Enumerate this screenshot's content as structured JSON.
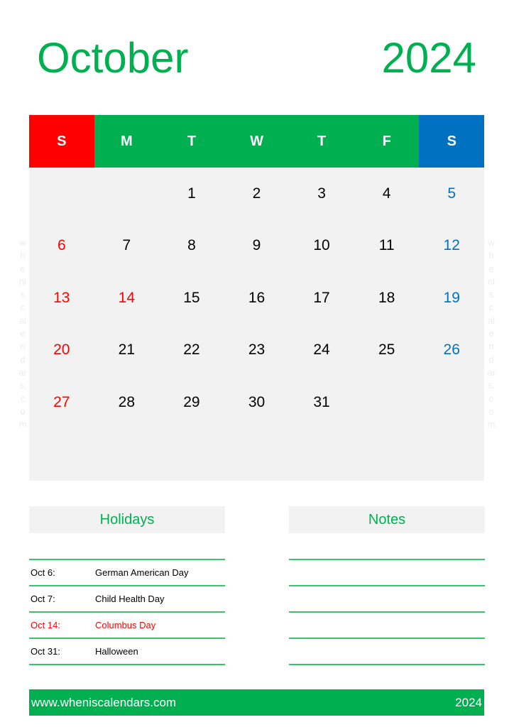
{
  "header": {
    "month": "October",
    "year": "2024"
  },
  "weekdays": [
    "S",
    "M",
    "T",
    "W",
    "T",
    "F",
    "S"
  ],
  "colors": {
    "accent": "#00b050",
    "sunday": "#ff0000",
    "saturday": "#0070c0",
    "grid_bg": "#f2f2f2"
  },
  "weeks": [
    [
      "",
      "",
      "1",
      "2",
      "3",
      "4",
      "5"
    ],
    [
      "6",
      "7",
      "8",
      "9",
      "10",
      "11",
      "12"
    ],
    [
      "13",
      "14",
      "15",
      "16",
      "17",
      "18",
      "19"
    ],
    [
      "20",
      "21",
      "22",
      "23",
      "24",
      "25",
      "26"
    ],
    [
      "27",
      "28",
      "29",
      "30",
      "31",
      "",
      ""
    ],
    [
      "",
      "",
      "",
      "",
      "",
      "",
      ""
    ]
  ],
  "highlighted_days": [
    "14"
  ],
  "watermark": [
    "w",
    "h",
    "e",
    "ni",
    "s",
    "c",
    "al",
    "e",
    "n",
    "d",
    "ar",
    "s.",
    "c",
    "o",
    "m"
  ],
  "holidays": {
    "title": "Holidays",
    "items": [
      {
        "date": "Oct 6:",
        "name": "German American Day",
        "highlight": false
      },
      {
        "date": "Oct 7:",
        "name": "Child Health Day",
        "highlight": false
      },
      {
        "date": "Oct 14:",
        "name": "Columbus Day",
        "highlight": true
      },
      {
        "date": "Oct 31:",
        "name": "Halloween",
        "highlight": false
      }
    ]
  },
  "notes": {
    "title": "Notes",
    "line_count": 4
  },
  "footer": {
    "url": "www.wheniscalendars.com",
    "year": "2024"
  }
}
